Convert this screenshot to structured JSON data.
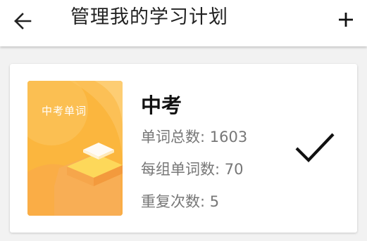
{
  "header": {
    "title": "管理我的学习计划",
    "back_icon": "back-arrow-icon",
    "add_icon": "plus-icon"
  },
  "plan": {
    "cover_label": "中考单词",
    "name": "中考",
    "total_words": "单词总数: 1603",
    "words_per_group": "每组单词数: 70",
    "repeat_count": "重复次数: 5",
    "selected": true,
    "selected_icon": "checkmark-icon"
  },
  "colors": {
    "cover_base": "#fbb63e",
    "cover_accent": "#fdd85a"
  }
}
